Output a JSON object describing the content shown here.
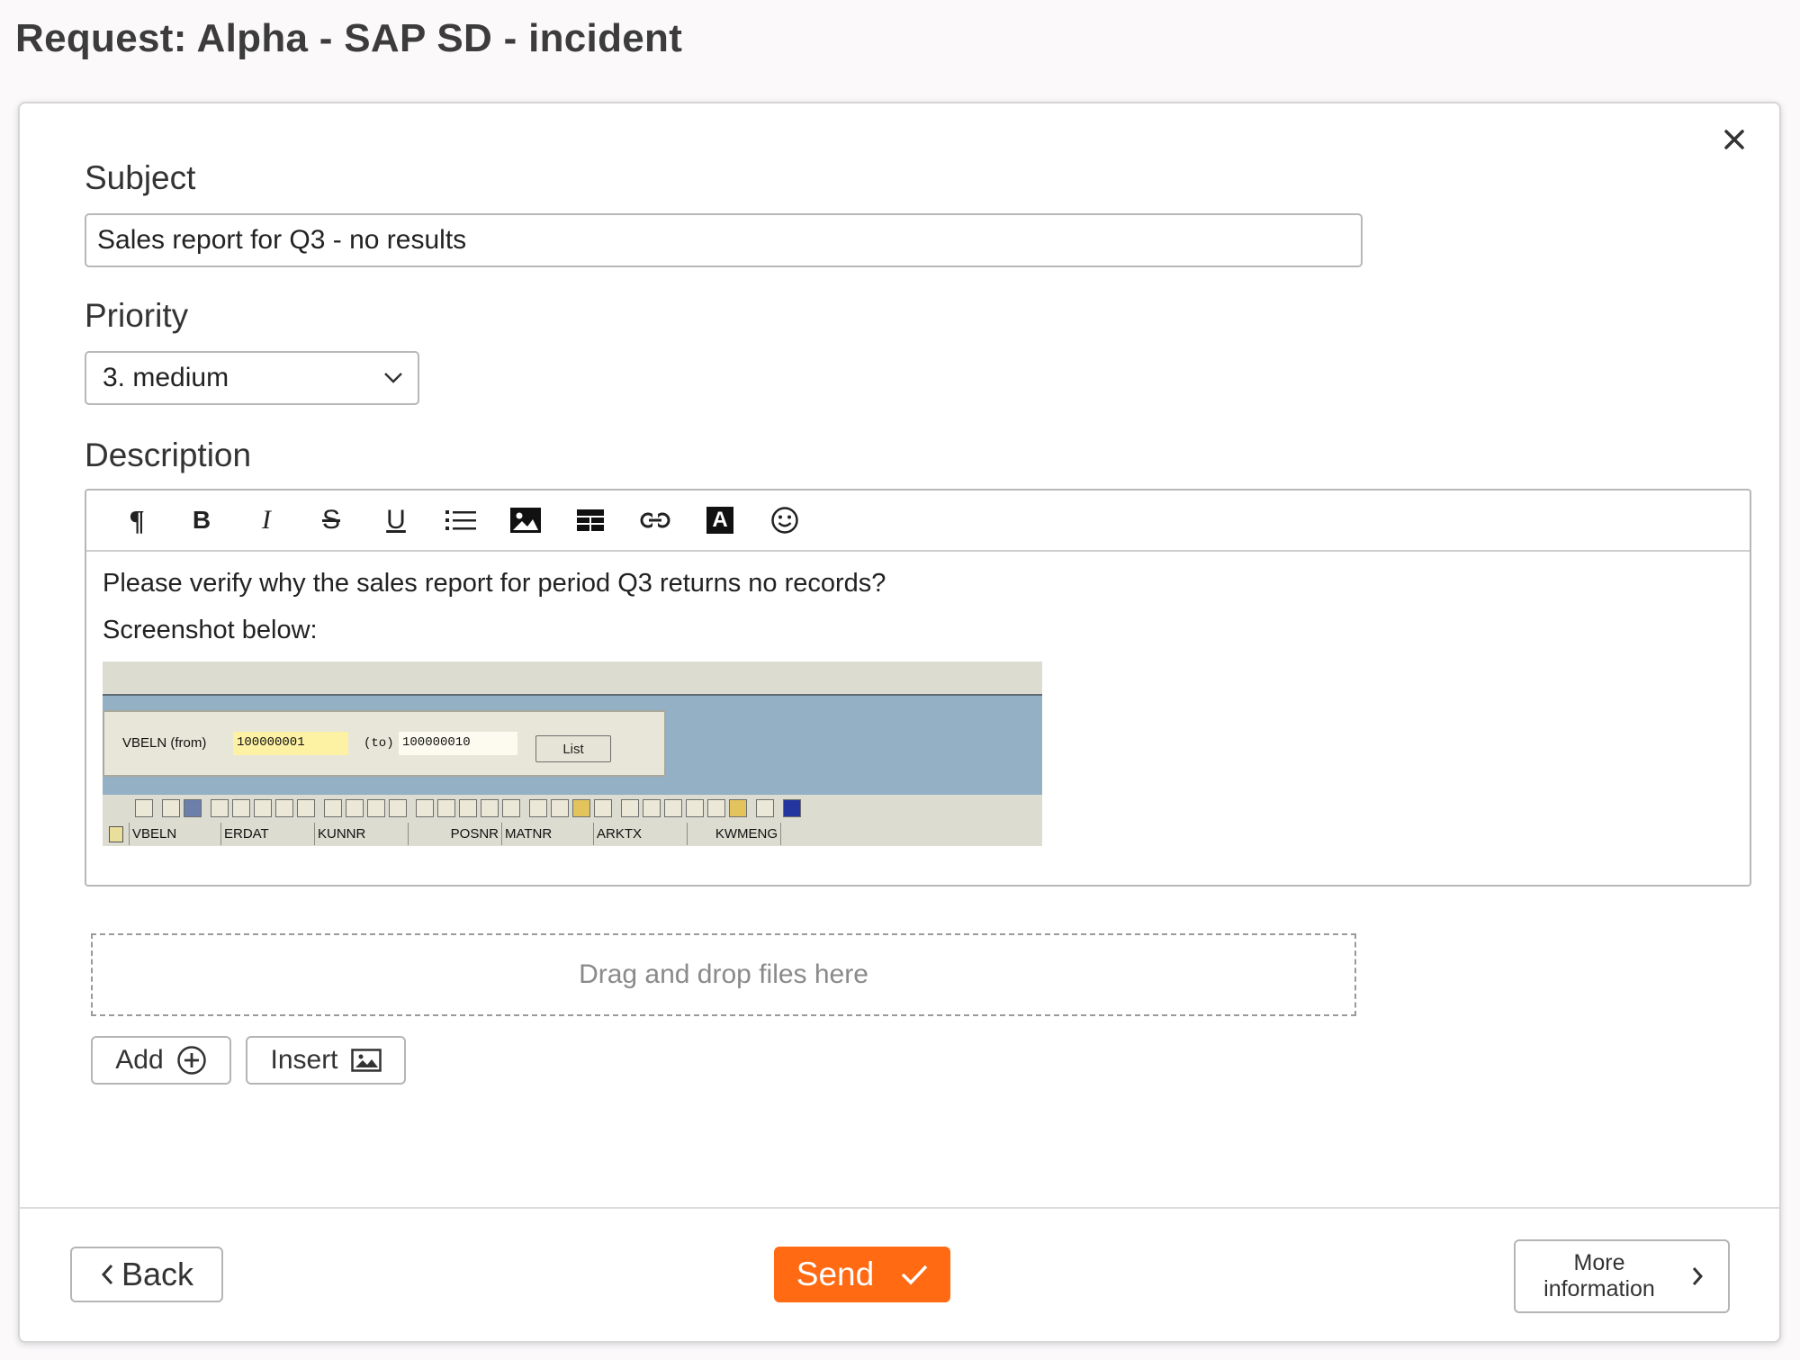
{
  "page": {
    "title": "Request: Alpha - SAP SD - incident"
  },
  "form": {
    "subject_label": "Subject",
    "subject_value": "Sales report for Q3 - no results",
    "priority_label": "Priority",
    "priority_selected": "3. medium",
    "description_label": "Description"
  },
  "editor": {
    "toolbar": [
      {
        "name": "paragraph-icon",
        "glyph": "¶"
      },
      {
        "name": "bold-icon",
        "glyph": "B"
      },
      {
        "name": "italic-icon",
        "glyph": "I"
      },
      {
        "name": "strikethrough-icon",
        "glyph": "S"
      },
      {
        "name": "underline-icon",
        "glyph": "U"
      },
      {
        "name": "bullet-list-icon"
      },
      {
        "name": "image-icon"
      },
      {
        "name": "table-icon"
      },
      {
        "name": "link-icon"
      },
      {
        "name": "text-color-icon",
        "glyph": "A"
      },
      {
        "name": "emoji-icon"
      }
    ],
    "line1": "Please verify why the sales report for period Q3 returns no records?",
    "line2": "Screenshot below:"
  },
  "sap": {
    "from_label": "VBELN (from)",
    "from_value": "100000001",
    "to_label": "(to)",
    "to_value": "100000010",
    "list_button": "List",
    "columns": [
      "VBELN",
      "ERDAT",
      "KUNNR",
      "POSNR",
      "MATNR",
      "ARKTX",
      "KWMENG"
    ]
  },
  "attachments": {
    "dropzone_text": "Drag and drop files here",
    "add_label": "Add",
    "insert_label": "Insert"
  },
  "footer": {
    "back_label": "Back",
    "send_label": "Send",
    "more_label": "More information"
  },
  "colors": {
    "accent": "#ff6a13",
    "sap_blue": "#93b0c4",
    "sap_field_yellow": "#fdf1a4"
  }
}
